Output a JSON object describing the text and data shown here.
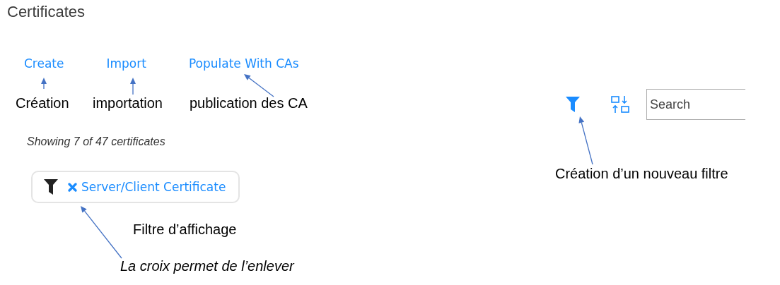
{
  "title": "Certificates",
  "actions": [
    "Create",
    "Import",
    "Populate With CAs"
  ],
  "search": {
    "placeholder": "Search"
  },
  "summary": "Showing 7 of 47 certificates",
  "active_filters": [
    {
      "label": "Server/Client Certificate"
    }
  ],
  "annotations": [
    {
      "text": "Création",
      "italic": false
    },
    {
      "text": "importation",
      "italic": false
    },
    {
      "text": "publication des CA",
      "italic": false
    },
    {
      "text": "Création d’un nouveau filtre",
      "italic": false
    },
    {
      "text": "Filtre d’affichage",
      "italic": false
    },
    {
      "text": "La croix permet de l’enlever",
      "italic": true
    }
  ]
}
